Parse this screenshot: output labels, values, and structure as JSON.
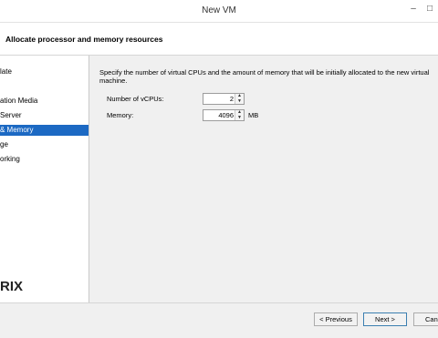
{
  "window": {
    "title": "New VM"
  },
  "header": {
    "title": "Allocate processor and memory resources"
  },
  "sidebar": {
    "items": [
      {
        "label": "late",
        "selected": false
      },
      {
        "label": "ation Media",
        "selected": false
      },
      {
        "label": " Server",
        "selected": false
      },
      {
        "label": "& Memory",
        "selected": true
      },
      {
        "label": "ge",
        "selected": false
      },
      {
        "label": "orking",
        "selected": false
      }
    ],
    "brand": "RIX"
  },
  "main": {
    "description": "Specify the number of virtual CPUs and the amount of memory that will be initially allocated to the new virtual machine.",
    "vcpus": {
      "label": "Number of vCPUs:",
      "value": "2"
    },
    "memory": {
      "label": "Memory:",
      "value": "4096",
      "unit": "MB"
    }
  },
  "footer": {
    "previous_label": "< Previous",
    "next_label": "Next >",
    "cancel_label": "Canc"
  },
  "colors": {
    "selection": "#1c69c3"
  }
}
